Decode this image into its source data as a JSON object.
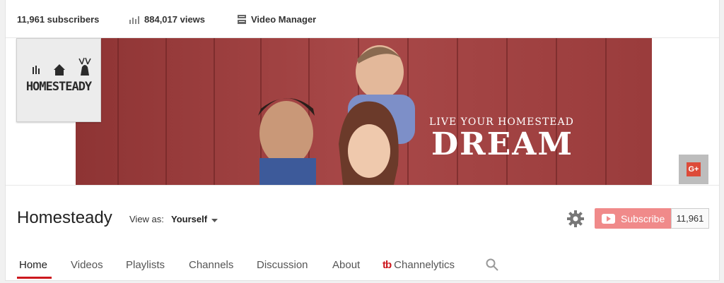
{
  "stats": {
    "subscribers": "11,961 subscribers",
    "views": "884,017 views",
    "video_manager": "Video Manager"
  },
  "banner": {
    "tagline": "LIVE YOUR HOMESTEAD",
    "headline": "DREAM",
    "gplus_label": "G+"
  },
  "logo": {
    "text": "HOMESTEADY"
  },
  "channel": {
    "name": "Homesteady",
    "view_as_label": "View as:",
    "view_as_value": "Yourself",
    "subscribe_label": "Subscribe",
    "subscriber_count": "11,961"
  },
  "tabs": [
    {
      "label": "Home",
      "active": true
    },
    {
      "label": "Videos"
    },
    {
      "label": "Playlists"
    },
    {
      "label": "Channels"
    },
    {
      "label": "Discussion"
    },
    {
      "label": "About"
    },
    {
      "label": "Channelytics",
      "prefix": "tb"
    }
  ],
  "colors": {
    "accent": "#cc181e",
    "subscribe": "#f08a8a",
    "banner_wood": "#9a3b3b"
  },
  "icons": [
    "bar-chart-icon",
    "video-manager-icon",
    "gear-icon",
    "youtube-play-icon",
    "chevron-down-icon",
    "search-icon",
    "gplus-icon",
    "tubebuddy-icon"
  ]
}
